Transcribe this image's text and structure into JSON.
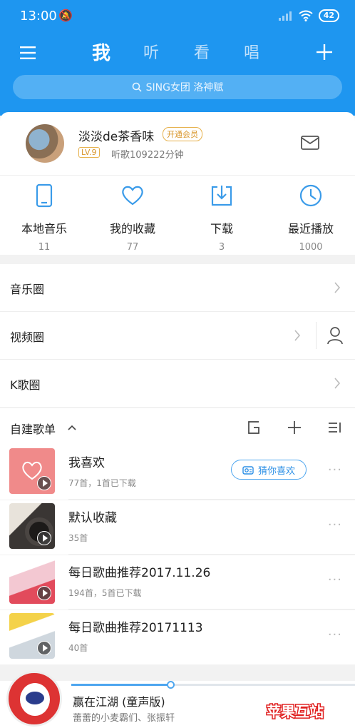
{
  "status_bar": {
    "time": "13:00",
    "battery": "42"
  },
  "nav": {
    "tabs": [
      "我",
      "听",
      "看",
      "唱"
    ],
    "active_tab": "我"
  },
  "search": {
    "placeholder": "SING女团 洛神赋"
  },
  "profile": {
    "username": "淡淡de茶香味",
    "vip_label": "开通会员",
    "level": "LV.9",
    "listen_time": "听歌109222分钟"
  },
  "quick_links": [
    {
      "label": "本地音乐",
      "count": "11",
      "icon": "phone-icon"
    },
    {
      "label": "我的收藏",
      "count": "77",
      "icon": "heart-icon"
    },
    {
      "label": "下载",
      "count": "3",
      "icon": "download-icon"
    },
    {
      "label": "最近播放",
      "count": "1000",
      "icon": "clock-icon"
    }
  ],
  "circles": [
    {
      "label": "音乐圈"
    },
    {
      "label": "视频圈"
    },
    {
      "label": "K歌圈"
    }
  ],
  "playlists_section": {
    "title": "自建歌单"
  },
  "playlists": [
    {
      "name": "我喜欢",
      "subtitle": "77首，1首已下载",
      "action": "猜你喜欢"
    },
    {
      "name": "默认收藏",
      "subtitle": "35首"
    },
    {
      "name": "每日歌曲推荐2017.11.26",
      "subtitle": "194首，5首已下载"
    },
    {
      "name": "每日歌曲推荐20171113",
      "subtitle": "40首"
    }
  ],
  "now_playing": {
    "title": "赢在江湖 (童声版)",
    "artist": "蕾蕾的小麦霸们、张振轩",
    "progress": 0.35
  },
  "watermark": {
    "text": "苹果互站"
  },
  "colors": {
    "brand": "#1e96f0",
    "accent": "#2b8fe6",
    "vip": "#d9962b"
  }
}
